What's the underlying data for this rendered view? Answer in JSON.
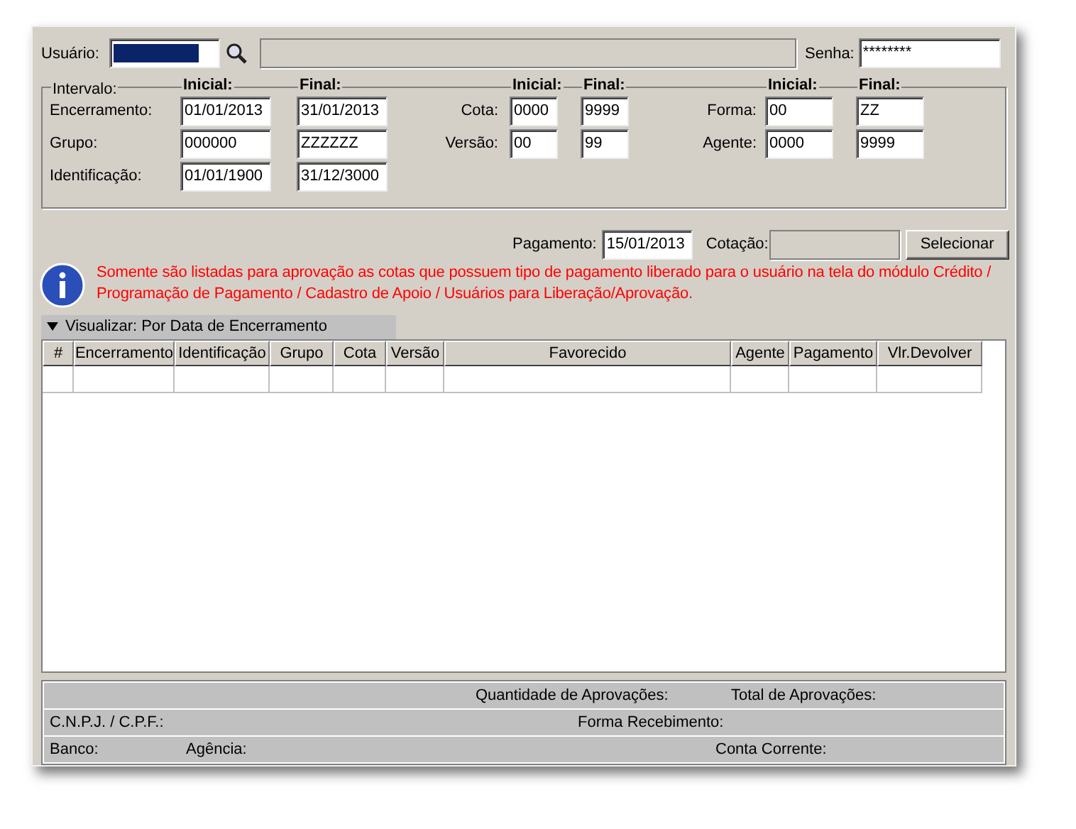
{
  "user": {
    "label": "Usuário:",
    "text_selected": true
  },
  "password": {
    "label": "Senha:",
    "value": "********"
  },
  "interval": {
    "label": "Intervalo:",
    "groups": [
      {
        "initial_label": "Inicial:",
        "final_label": "Final:",
        "rows": [
          {
            "label": "Encerramento:",
            "initial": "01/01/2013",
            "final": "31/01/2013"
          },
          {
            "label": "Grupo:",
            "initial": "000000",
            "final": "ZZZZZZ"
          },
          {
            "label": "Identificação:",
            "initial": "01/01/1900",
            "final": "31/12/3000"
          }
        ]
      },
      {
        "initial_label": "Inicial:",
        "final_label": "Final:",
        "rows": [
          {
            "label": "Cota:",
            "initial": "0000",
            "final": "9999"
          },
          {
            "label": "Versão:",
            "initial": "00",
            "final": "99"
          }
        ]
      },
      {
        "initial_label": "Inicial:",
        "final_label": "Final:",
        "rows": [
          {
            "label": "Forma:",
            "initial": "00",
            "final": "ZZ"
          },
          {
            "label": "Agente:",
            "initial": "0000",
            "final": "9999"
          }
        ]
      }
    ]
  },
  "payment": {
    "label": "Pagamento:",
    "value": "15/01/2013"
  },
  "quotation": {
    "label": "Cotação:"
  },
  "select_button": "Selecionar",
  "info_message": "Somente são listadas para aprovação as cotas que possuem tipo de pagamento liberado para o usuário na tela do módulo Crédito / Programação de Pagamento / Cadastro de Apoio / Usuários para Liberação/Aprovação.",
  "view_bar": {
    "expanded": true,
    "label": "Visualizar: Por Data de Encerramento"
  },
  "table": {
    "columns": [
      "#",
      "Encerramento",
      "Identificação",
      "Grupo",
      "Cota",
      "Versão",
      "Favorecido",
      "Agente",
      "Pagamento",
      "Vlr.Devolver"
    ]
  },
  "footer": [
    [
      "Quantidade de Aprovações:",
      "Total de Aprovações:"
    ],
    [
      "C.N.P.J. / C.P.F.:",
      "Forma Recebimento:"
    ],
    [
      "Banco:",
      "Agência:",
      "Conta Corrente:"
    ]
  ]
}
